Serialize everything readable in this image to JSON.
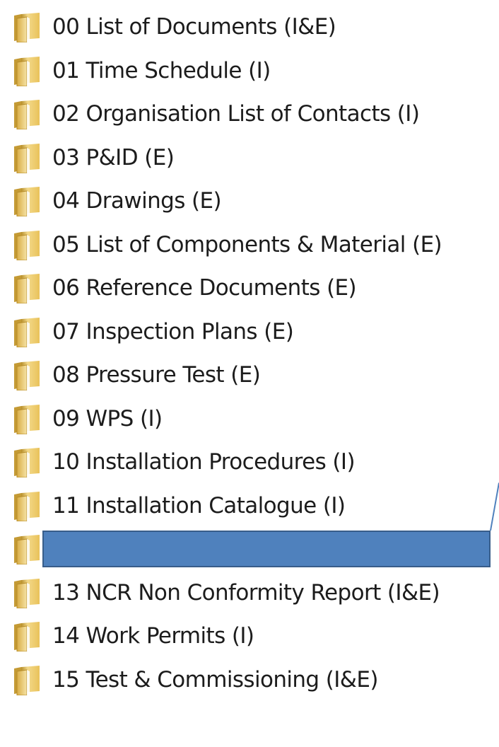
{
  "folders": [
    {
      "label": "00 List of Documents (I&E)",
      "icon": "folder-icon"
    },
    {
      "label": "01 Time Schedule (I)",
      "icon": "folder-icon"
    },
    {
      "label": "02 Organisation List of Contacts (I)",
      "icon": "folder-icon"
    },
    {
      "label": "03 P&ID (E)",
      "icon": "folder-icon"
    },
    {
      "label": "04 Drawings (E)",
      "icon": "folder-icon"
    },
    {
      "label": "05 List of Components & Material (E)",
      "icon": "folder-icon"
    },
    {
      "label": "06 Reference Documents (E)",
      "icon": "folder-icon"
    },
    {
      "label": "07 Inspection Plans (E)",
      "icon": "folder-icon"
    },
    {
      "label": "08 Pressure Test (E)",
      "icon": "folder-icon"
    },
    {
      "label": "09 WPS (I)",
      "icon": "folder-icon"
    },
    {
      "label": "10 Installation Procedures (I)",
      "icon": "folder-icon"
    },
    {
      "label": "11 Installation Catalogue (I)",
      "icon": "folder-icon"
    },
    {
      "label": "",
      "icon": "folder-icon"
    },
    {
      "label": "13 NCR Non Conformity Report (I&E)",
      "icon": "folder-icon"
    },
    {
      "label": "14 Work Permits (I)",
      "icon": "folder-icon"
    },
    {
      "label": "15 Test & Commissioning (I&E)",
      "icon": "folder-icon"
    }
  ],
  "callout": {
    "fill_color": "#4f81bd",
    "border_color": "#385d8a"
  }
}
